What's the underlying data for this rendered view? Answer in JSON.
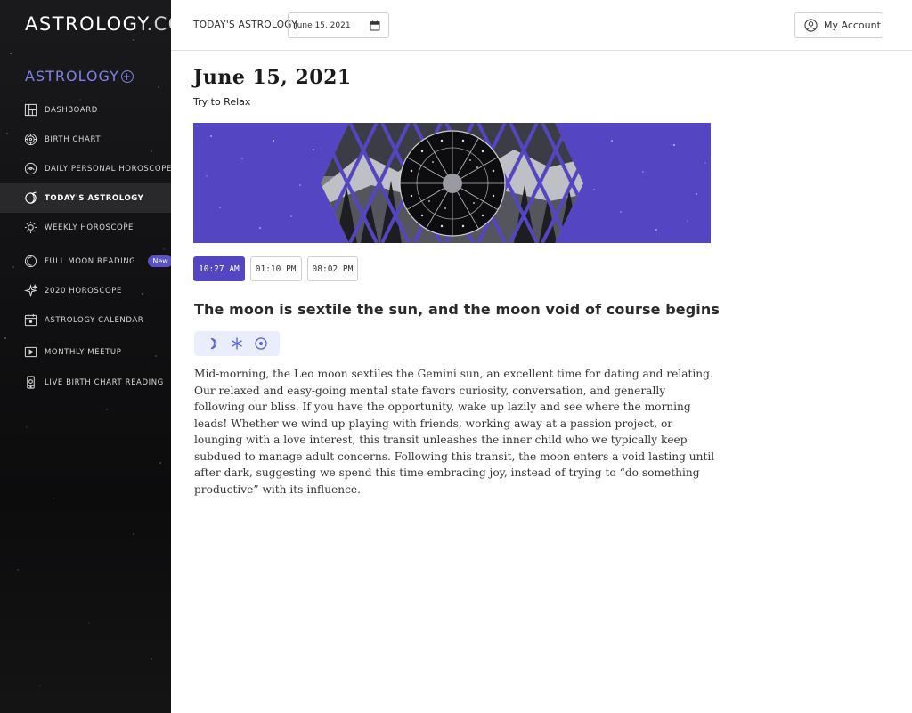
{
  "sidebar": {
    "brand": "ASTROLOGY",
    "brand_suffix": ".COM",
    "plus_label": "ASTROLOGY",
    "items": [
      {
        "label": "Dashboard",
        "icon": "dashboard-icon"
      },
      {
        "label": "Birth Chart",
        "icon": "birth-chart-icon"
      },
      {
        "label": "Daily Personal Horoscope",
        "icon": "daily-horoscope-icon"
      },
      {
        "label": "Today's Astrology",
        "icon": "todays-astrology-icon",
        "active": true
      },
      {
        "label": "Weekly Horoscope",
        "icon": "sun-icon"
      },
      {
        "label": "Full Moon Reading",
        "icon": "moon-icon",
        "badge": "New"
      },
      {
        "label": "2020 Horoscope",
        "icon": "sparkle-icon"
      },
      {
        "label": "Astrology Calendar",
        "icon": "calendar-icon"
      },
      {
        "label": "Monthly Meetup",
        "icon": "video-play-icon"
      },
      {
        "label": "Live Birth Chart Reading",
        "icon": "phone-icon"
      }
    ]
  },
  "topbar": {
    "title": "TODAY'S ASTROLOGY",
    "date_value": "June 15, 2021",
    "account_label": "My Account"
  },
  "main": {
    "title": "June 15, 2021",
    "subtitle": "Try to Relax",
    "times": [
      "10:27 AM",
      "01:10 PM",
      "08:02 PM"
    ],
    "selected_time": "10:27 AM",
    "event_title": "The moon is sextile the sun, and the moon void of course begins",
    "aspect_icons": [
      "moon-icon",
      "sextile-icon",
      "sun-symbol-icon"
    ],
    "body": "Mid-morning, the Leo moon sextiles the Gemini sun, an excellent time for dating and relating. Our relaxed and easy-going mental state favors curiosity, conversation, and generally following our bliss. If you have the opportunity, wake up lazily and see where the morning leads!  Whether we wind up playing with friends, working away at a passion project, or lounging with a love interest, this transit unleashes the inner child who we typically keep subdued to manage adult concerns.  Following this transit, the moon enters a void lasting until after dark, suggesting we spend this time embracing joy, instead of trying to “do something productive” with its influence."
  },
  "colors": {
    "accent": "#5446c2",
    "sidebar_bg": "#111113",
    "logo_accent": "#7f82e8",
    "aspect_pill_bg": "#eaeefc"
  }
}
